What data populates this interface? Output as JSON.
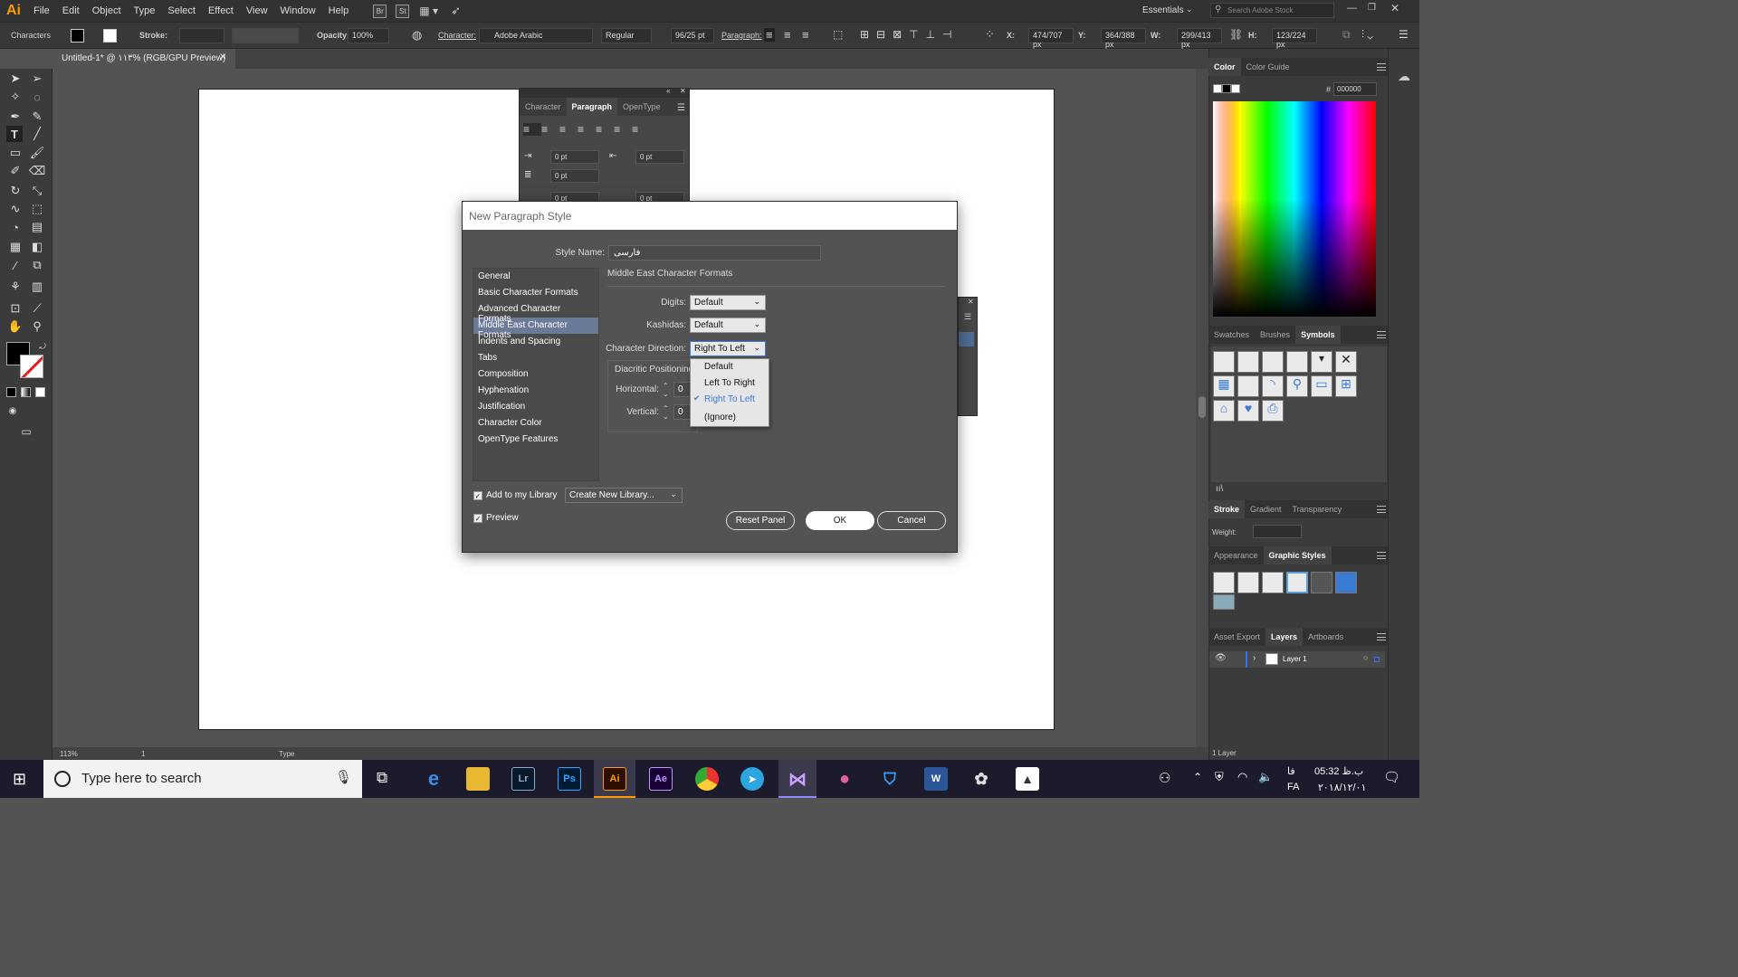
{
  "app": {
    "logo": "Ai"
  },
  "menu": [
    "File",
    "Edit",
    "Object",
    "Type",
    "Select",
    "Effect",
    "View",
    "Window",
    "Help"
  ],
  "bridge_buttons": [
    "Br",
    "St"
  ],
  "workspace": "Essentials",
  "stock_search_placeholder": "Search Adobe Stock",
  "control_bar": {
    "panel_label": "Characters",
    "stroke_label": "Stroke:",
    "opacity_label": "Opacity:",
    "opacity_value": "100%",
    "character_label": "Character:",
    "font": "Adobe Arabic",
    "style": "Regular",
    "size": "96/25 pt",
    "paragraph_label": "Paragraph:",
    "x_label": "X:",
    "x_value": "474/707 px",
    "y_label": "Y:",
    "y_value": "364/388 px",
    "w_label": "W:",
    "w_value": "299/413 px",
    "h_label": "H:",
    "h_value": "123/224 px"
  },
  "document_tab": "Untitled-1* @ ۱۱۳% (RGB/GPU Preview)",
  "paragraph_panel": {
    "tabs": [
      "Character",
      "Paragraph",
      "OpenType"
    ],
    "fields": [
      "0 pt",
      "0 pt",
      "0 pt",
      "0 pt",
      "0 pt"
    ]
  },
  "dialog": {
    "title": "New Paragraph Style",
    "style_name_label": "Style Name:",
    "style_name_value": "فارسی",
    "categories": [
      "General",
      "Basic Character Formats",
      "Advanced Character Formats",
      "Middle East Character Formats",
      "Indents and Spacing",
      "Tabs",
      "Composition",
      "Hyphenation",
      "Justification",
      "Character Color",
      "OpenType Features"
    ],
    "selected_category": "Middle East Character Formats",
    "section_title": "Middle East Character Formats",
    "digits_label": "Digits:",
    "digits_value": "Default",
    "kashidas_label": "Kashidas:",
    "kashidas_value": "Default",
    "direction_label": "Character Direction:",
    "direction_value": "Right To Left",
    "diacritic_label": "Diacritic Positioning",
    "horizontal_label": "Horizontal:",
    "horizontal_value": "0",
    "vertical_label": "Vertical:",
    "vertical_value": "0",
    "dropdown_options": [
      "Default",
      "Left To Right",
      "Right To Left",
      "(Ignore)"
    ],
    "dropdown_checked": "Right To Left",
    "add_library_label": "Add to my Library",
    "library_select": "Create New Library...",
    "preview_label": "Preview",
    "reset_button": "Reset Panel",
    "ok_button": "OK",
    "cancel_button": "Cancel"
  },
  "right_panels": {
    "color_tabs": [
      "Color",
      "Color Guide"
    ],
    "hex_label": "#",
    "hex_value": "000000",
    "swatch_tabs": [
      "Swatches",
      "Brushes",
      "Symbols"
    ],
    "stroke_tabs": [
      "Stroke",
      "Gradient",
      "Transparency"
    ],
    "weight_label": "Weight:",
    "appearance_tabs": [
      "Appearance",
      "Graphic Styles"
    ],
    "layers_tabs": [
      "Asset Export",
      "Layers",
      "Artboards"
    ],
    "layer_name": "Layer 1",
    "layers_count": "1 Layer"
  },
  "status_bar": {
    "zoom": "113%",
    "page": "1",
    "tool": "Type"
  },
  "taskbar": {
    "search_placeholder": "Type here to search",
    "apps": [
      "Lr",
      "Ps",
      "Ai",
      "Ae",
      "W"
    ],
    "time": "05:32 ب.ظ",
    "date": "۲۰۱۸/۱۲/۰۱",
    "lang": "FA",
    "lang_fa": "فا"
  }
}
